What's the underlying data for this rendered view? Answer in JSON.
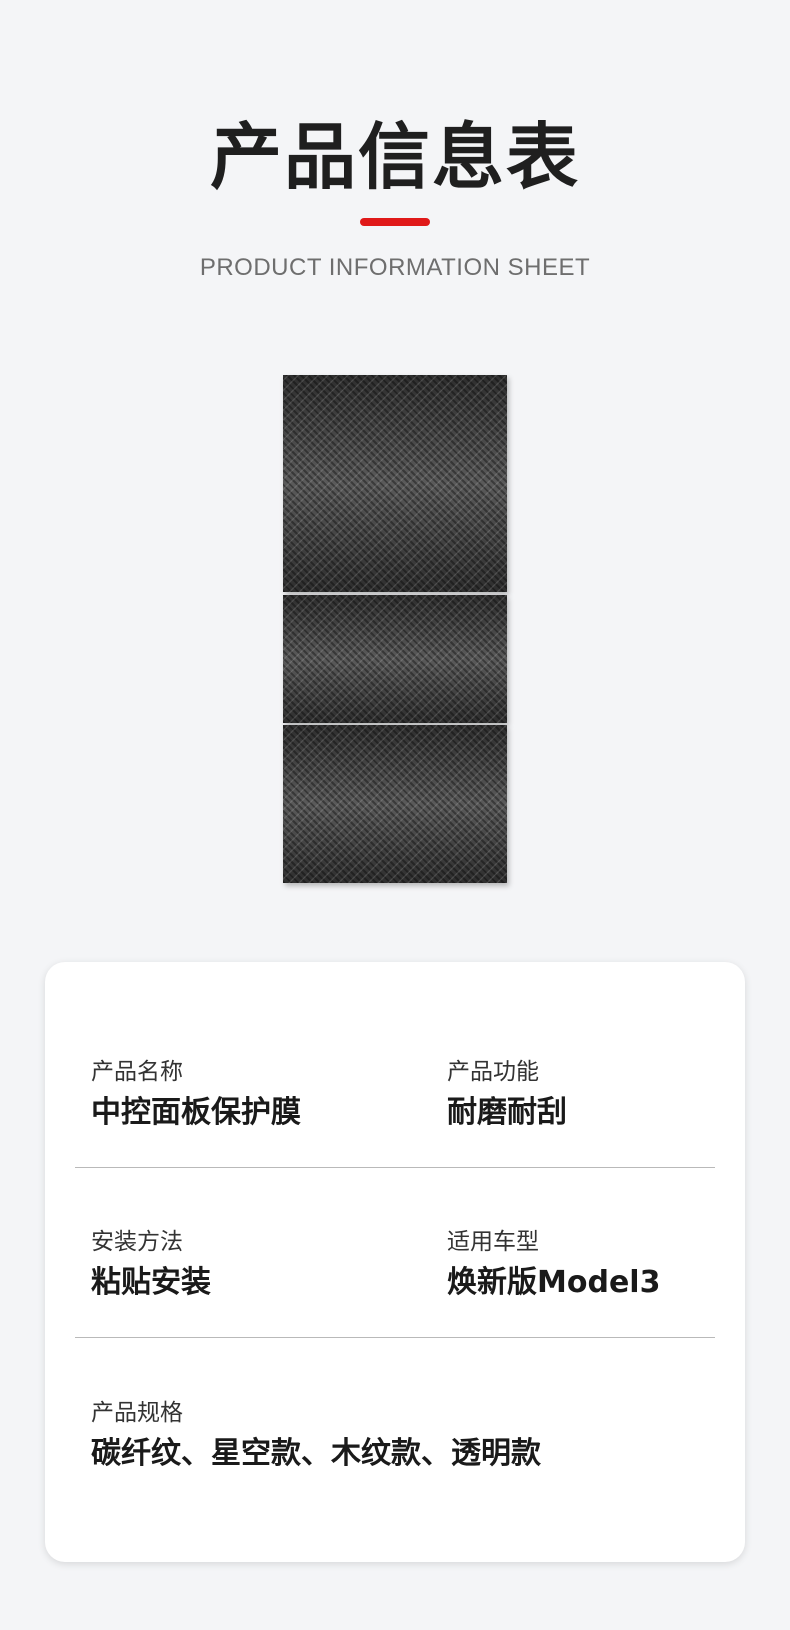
{
  "header": {
    "title": "产品信息表",
    "subtitle": "PRODUCT INFORMATION SHEET",
    "accent_color": "#e01919"
  },
  "product_image": {
    "panels": [
      "carbon-fiber-panel",
      "carbon-fiber-panel",
      "carbon-fiber-panel"
    ]
  },
  "info": {
    "product_name": {
      "label": "产品名称",
      "value": "中控面板保护膜"
    },
    "product_function": {
      "label": "产品功能",
      "value": "耐磨耐刮"
    },
    "install_method": {
      "label": "安装方法",
      "value": "粘贴安装"
    },
    "compatible_model": {
      "label": "适用车型",
      "value": "焕新版Model3"
    },
    "product_spec": {
      "label": "产品规格",
      "value": "碳纤纹、星空款、木纹款、透明款"
    }
  }
}
